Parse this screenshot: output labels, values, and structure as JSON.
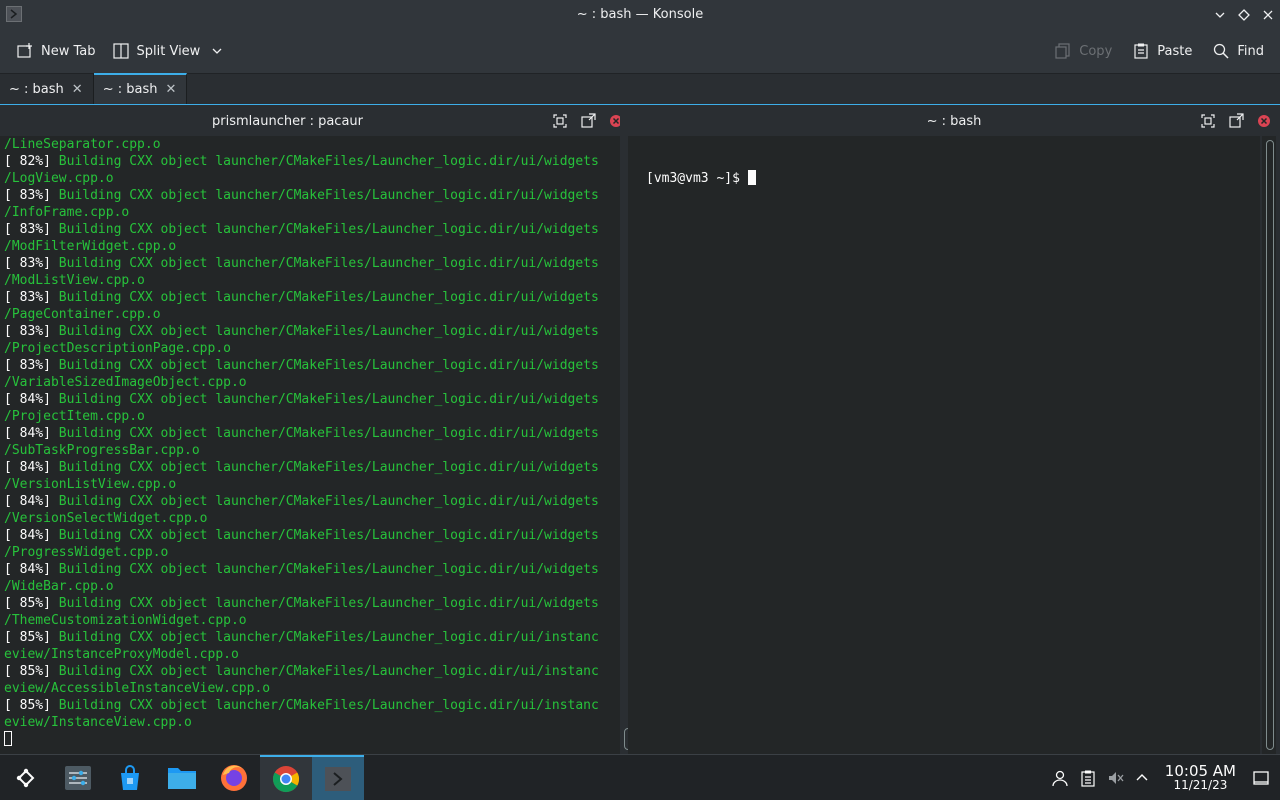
{
  "window": {
    "title": "~ : bash — Konsole"
  },
  "toolbar": {
    "new_tab": "New Tab",
    "split_view": "Split View",
    "copy": "Copy",
    "paste": "Paste",
    "find": "Find"
  },
  "tabs": [
    {
      "label": "~ : bash"
    },
    {
      "label": "~ : bash"
    }
  ],
  "panes": {
    "left_title": "prismlauncher : pacaur",
    "right_title": "~ : bash",
    "right_prompt": "[vm3@vm3 ~]$ "
  },
  "left_terminal": [
    {
      "w": "",
      "g": "/LineSeparator.cpp.o"
    },
    {
      "w": "[ 82%] ",
      "g": "Building CXX object launcher/CMakeFiles/Launcher_logic.dir/ui/widgets"
    },
    {
      "w": "",
      "g": "/LogView.cpp.o"
    },
    {
      "w": "[ 83%] ",
      "g": "Building CXX object launcher/CMakeFiles/Launcher_logic.dir/ui/widgets"
    },
    {
      "w": "",
      "g": "/InfoFrame.cpp.o"
    },
    {
      "w": "[ 83%] ",
      "g": "Building CXX object launcher/CMakeFiles/Launcher_logic.dir/ui/widgets"
    },
    {
      "w": "",
      "g": "/ModFilterWidget.cpp.o"
    },
    {
      "w": "[ 83%] ",
      "g": "Building CXX object launcher/CMakeFiles/Launcher_logic.dir/ui/widgets"
    },
    {
      "w": "",
      "g": "/ModListView.cpp.o"
    },
    {
      "w": "[ 83%] ",
      "g": "Building CXX object launcher/CMakeFiles/Launcher_logic.dir/ui/widgets"
    },
    {
      "w": "",
      "g": "/PageContainer.cpp.o"
    },
    {
      "w": "[ 83%] ",
      "g": "Building CXX object launcher/CMakeFiles/Launcher_logic.dir/ui/widgets"
    },
    {
      "w": "",
      "g": "/ProjectDescriptionPage.cpp.o"
    },
    {
      "w": "[ 83%] ",
      "g": "Building CXX object launcher/CMakeFiles/Launcher_logic.dir/ui/widgets"
    },
    {
      "w": "",
      "g": "/VariableSizedImageObject.cpp.o"
    },
    {
      "w": "[ 84%] ",
      "g": "Building CXX object launcher/CMakeFiles/Launcher_logic.dir/ui/widgets"
    },
    {
      "w": "",
      "g": "/ProjectItem.cpp.o"
    },
    {
      "w": "[ 84%] ",
      "g": "Building CXX object launcher/CMakeFiles/Launcher_logic.dir/ui/widgets"
    },
    {
      "w": "",
      "g": "/SubTaskProgressBar.cpp.o"
    },
    {
      "w": "[ 84%] ",
      "g": "Building CXX object launcher/CMakeFiles/Launcher_logic.dir/ui/widgets"
    },
    {
      "w": "",
      "g": "/VersionListView.cpp.o"
    },
    {
      "w": "[ 84%] ",
      "g": "Building CXX object launcher/CMakeFiles/Launcher_logic.dir/ui/widgets"
    },
    {
      "w": "",
      "g": "/VersionSelectWidget.cpp.o"
    },
    {
      "w": "[ 84%] ",
      "g": "Building CXX object launcher/CMakeFiles/Launcher_logic.dir/ui/widgets"
    },
    {
      "w": "",
      "g": "/ProgressWidget.cpp.o"
    },
    {
      "w": "[ 84%] ",
      "g": "Building CXX object launcher/CMakeFiles/Launcher_logic.dir/ui/widgets"
    },
    {
      "w": "",
      "g": "/WideBar.cpp.o"
    },
    {
      "w": "[ 85%] ",
      "g": "Building CXX object launcher/CMakeFiles/Launcher_logic.dir/ui/widgets"
    },
    {
      "w": "",
      "g": "/ThemeCustomizationWidget.cpp.o"
    },
    {
      "w": "[ 85%] ",
      "g": "Building CXX object launcher/CMakeFiles/Launcher_logic.dir/ui/instanc"
    },
    {
      "w": "",
      "g": "eview/InstanceProxyModel.cpp.o"
    },
    {
      "w": "[ 85%] ",
      "g": "Building CXX object launcher/CMakeFiles/Launcher_logic.dir/ui/instanc"
    },
    {
      "w": "",
      "g": "eview/AccessibleInstanceView.cpp.o"
    },
    {
      "w": "[ 85%] ",
      "g": "Building CXX object launcher/CMakeFiles/Launcher_logic.dir/ui/instanc"
    },
    {
      "w": "",
      "g": "eview/InstanceView.cpp.o"
    }
  ],
  "taskbar": {
    "items": [
      "application-launcher-icon",
      "system-settings-icon",
      "discover-store-icon",
      "file-manager-icon",
      "firefox-icon",
      "chrome-icon",
      "konsole-icon"
    ]
  },
  "tray": {
    "time": "10:05 AM",
    "date": "11/21/23"
  },
  "colors": {
    "accent": "#3daee9",
    "terminal_bg": "#232627",
    "terminal_green": "#27c23b"
  }
}
